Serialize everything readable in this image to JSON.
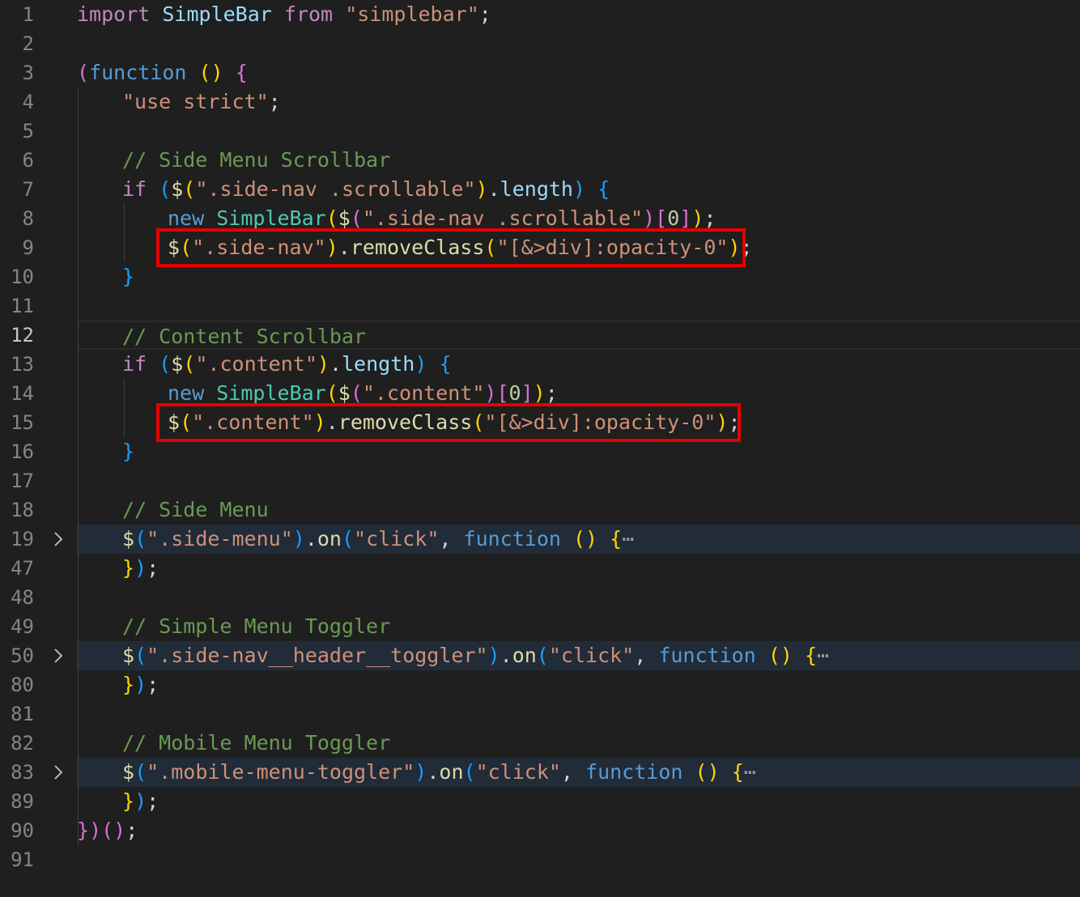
{
  "editor": {
    "lines": [
      {
        "num": "1",
        "indent": 0,
        "tokens": [
          [
            "kw",
            "import"
          ],
          [
            "plain",
            " "
          ],
          [
            "prop",
            "SimpleBar"
          ],
          [
            "plain",
            " "
          ],
          [
            "kw",
            "from"
          ],
          [
            "plain",
            " "
          ],
          [
            "str",
            "\"simplebar\""
          ],
          [
            "plain",
            ";"
          ]
        ]
      },
      {
        "num": "2",
        "indent": 0,
        "tokens": []
      },
      {
        "num": "3",
        "indent": 0,
        "tokens": [
          [
            "p2",
            "("
          ],
          [
            "kw2",
            "function"
          ],
          [
            "plain",
            " "
          ],
          [
            "p1",
            "()"
          ],
          [
            "plain",
            " "
          ],
          [
            "p2",
            "{"
          ]
        ]
      },
      {
        "num": "4",
        "indent": 1,
        "tokens": [
          [
            "str",
            "\"use strict\""
          ],
          [
            "plain",
            ";"
          ]
        ]
      },
      {
        "num": "5",
        "indent": 0,
        "tokens": []
      },
      {
        "num": "6",
        "indent": 1,
        "tokens": [
          [
            "cmt",
            "// Side Menu Scrollbar"
          ]
        ]
      },
      {
        "num": "7",
        "indent": 1,
        "tokens": [
          [
            "kw",
            "if"
          ],
          [
            "plain",
            " "
          ],
          [
            "p3",
            "("
          ],
          [
            "fn",
            "$"
          ],
          [
            "p1",
            "("
          ],
          [
            "str",
            "\".side-nav .scrollable\""
          ],
          [
            "p1",
            ")"
          ],
          [
            "plain",
            "."
          ],
          [
            "prop",
            "length"
          ],
          [
            "p3",
            ")"
          ],
          [
            "plain",
            " "
          ],
          [
            "p3",
            "{"
          ]
        ]
      },
      {
        "num": "8",
        "indent": 2,
        "tokens": [
          [
            "kw2",
            "new"
          ],
          [
            "plain",
            " "
          ],
          [
            "cls",
            "SimpleBar"
          ],
          [
            "p1",
            "("
          ],
          [
            "fn",
            "$"
          ],
          [
            "p2",
            "("
          ],
          [
            "str",
            "\".side-nav .scrollable\""
          ],
          [
            "p2",
            ")"
          ],
          [
            "p2",
            "["
          ],
          [
            "num",
            "0"
          ],
          [
            "p2",
            "]"
          ],
          [
            "p1",
            ")"
          ],
          [
            "plain",
            ";"
          ]
        ]
      },
      {
        "num": "9",
        "indent": 2,
        "tokens": [
          [
            "fn",
            "$"
          ],
          [
            "p1",
            "("
          ],
          [
            "str",
            "\".side-nav\""
          ],
          [
            "p1",
            ")"
          ],
          [
            "plain",
            "."
          ],
          [
            "fn",
            "removeClass"
          ],
          [
            "p1",
            "("
          ],
          [
            "str",
            "\"[&>div]:opacity-0\""
          ],
          [
            "p1",
            ")"
          ],
          [
            "plain",
            ";"
          ]
        ]
      },
      {
        "num": "10",
        "indent": 1,
        "tokens": [
          [
            "p3",
            "}"
          ]
        ]
      },
      {
        "num": "11",
        "indent": 0,
        "tokens": []
      },
      {
        "num": "12",
        "indent": 1,
        "tokens": [
          [
            "cmt",
            "// Content Scrollbar"
          ]
        ]
      },
      {
        "num": "13",
        "indent": 1,
        "tokens": [
          [
            "kw",
            "if"
          ],
          [
            "plain",
            " "
          ],
          [
            "p3",
            "("
          ],
          [
            "fn",
            "$"
          ],
          [
            "p1",
            "("
          ],
          [
            "str",
            "\".content\""
          ],
          [
            "p1",
            ")"
          ],
          [
            "plain",
            "."
          ],
          [
            "prop",
            "length"
          ],
          [
            "p3",
            ")"
          ],
          [
            "plain",
            " "
          ],
          [
            "p3",
            "{"
          ]
        ]
      },
      {
        "num": "14",
        "indent": 2,
        "tokens": [
          [
            "kw2",
            "new"
          ],
          [
            "plain",
            " "
          ],
          [
            "cls",
            "SimpleBar"
          ],
          [
            "p1",
            "("
          ],
          [
            "fn",
            "$"
          ],
          [
            "p2",
            "("
          ],
          [
            "str",
            "\".content\""
          ],
          [
            "p2",
            ")"
          ],
          [
            "p2",
            "["
          ],
          [
            "num",
            "0"
          ],
          [
            "p2",
            "]"
          ],
          [
            "p1",
            ")"
          ],
          [
            "plain",
            ";"
          ]
        ]
      },
      {
        "num": "15",
        "indent": 2,
        "tokens": [
          [
            "fn",
            "$"
          ],
          [
            "p1",
            "("
          ],
          [
            "str",
            "\".content\""
          ],
          [
            "p1",
            ")"
          ],
          [
            "plain",
            "."
          ],
          [
            "fn",
            "removeClass"
          ],
          [
            "p1",
            "("
          ],
          [
            "str",
            "\"[&>div]:opacity-0\""
          ],
          [
            "p1",
            ")"
          ],
          [
            "plain",
            ";"
          ]
        ]
      },
      {
        "num": "16",
        "indent": 1,
        "tokens": [
          [
            "p3",
            "}"
          ]
        ]
      },
      {
        "num": "17",
        "indent": 0,
        "tokens": []
      },
      {
        "num": "18",
        "indent": 1,
        "tokens": [
          [
            "cmt",
            "// Side Menu"
          ]
        ]
      },
      {
        "num": "19",
        "indent": 1,
        "fold": true,
        "tokens": [
          [
            "fn",
            "$"
          ],
          [
            "p3",
            "("
          ],
          [
            "str",
            "\".side-menu\""
          ],
          [
            "p3",
            ")"
          ],
          [
            "plain",
            "."
          ],
          [
            "fn",
            "on"
          ],
          [
            "p3",
            "("
          ],
          [
            "str",
            "\"click\""
          ],
          [
            "plain",
            ", "
          ],
          [
            "kw2",
            "function"
          ],
          [
            "plain",
            " "
          ],
          [
            "p1",
            "()"
          ],
          [
            "plain",
            " "
          ],
          [
            "p1",
            "{"
          ],
          [
            "ellipsis",
            "⋯"
          ]
        ]
      },
      {
        "num": "47",
        "indent": 1,
        "tokens": [
          [
            "p1",
            "}"
          ],
          [
            "p3",
            ")"
          ],
          [
            "plain",
            ";"
          ]
        ]
      },
      {
        "num": "48",
        "indent": 0,
        "tokens": []
      },
      {
        "num": "49",
        "indent": 1,
        "tokens": [
          [
            "cmt",
            "// Simple Menu Toggler"
          ]
        ]
      },
      {
        "num": "50",
        "indent": 1,
        "fold": true,
        "tokens": [
          [
            "fn",
            "$"
          ],
          [
            "p3",
            "("
          ],
          [
            "str",
            "\".side-nav__header__toggler\""
          ],
          [
            "p3",
            ")"
          ],
          [
            "plain",
            "."
          ],
          [
            "fn",
            "on"
          ],
          [
            "p3",
            "("
          ],
          [
            "str",
            "\"click\""
          ],
          [
            "plain",
            ", "
          ],
          [
            "kw2",
            "function"
          ],
          [
            "plain",
            " "
          ],
          [
            "p1",
            "()"
          ],
          [
            "plain",
            " "
          ],
          [
            "p1",
            "{"
          ],
          [
            "ellipsis",
            "⋯"
          ]
        ]
      },
      {
        "num": "80",
        "indent": 1,
        "tokens": [
          [
            "p1",
            "}"
          ],
          [
            "p3",
            ")"
          ],
          [
            "plain",
            ";"
          ]
        ]
      },
      {
        "num": "81",
        "indent": 0,
        "tokens": []
      },
      {
        "num": "82",
        "indent": 1,
        "tokens": [
          [
            "cmt",
            "// Mobile Menu Toggler"
          ]
        ]
      },
      {
        "num": "83",
        "indent": 1,
        "fold": true,
        "tokens": [
          [
            "fn",
            "$"
          ],
          [
            "p3",
            "("
          ],
          [
            "str",
            "\".mobile-menu-toggler\""
          ],
          [
            "p3",
            ")"
          ],
          [
            "plain",
            "."
          ],
          [
            "fn",
            "on"
          ],
          [
            "p3",
            "("
          ],
          [
            "str",
            "\"click\""
          ],
          [
            "plain",
            ", "
          ],
          [
            "kw2",
            "function"
          ],
          [
            "plain",
            " "
          ],
          [
            "p1",
            "()"
          ],
          [
            "plain",
            " "
          ],
          [
            "p1",
            "{"
          ],
          [
            "ellipsis",
            "⋯"
          ]
        ]
      },
      {
        "num": "89",
        "indent": 1,
        "tokens": [
          [
            "p1",
            "}"
          ],
          [
            "p3",
            ")"
          ],
          [
            "plain",
            ";"
          ]
        ]
      },
      {
        "num": "90",
        "indent": 0,
        "tokens": [
          [
            "p2",
            "}"
          ],
          [
            "p2",
            ")"
          ],
          [
            "p2",
            "()"
          ],
          [
            "plain",
            ";"
          ]
        ]
      },
      {
        "num": "91",
        "indent": 0,
        "tokens": []
      }
    ],
    "current_line": "12",
    "fold_icon": "chevron-right-icon",
    "highlight_color": "#e50000"
  }
}
